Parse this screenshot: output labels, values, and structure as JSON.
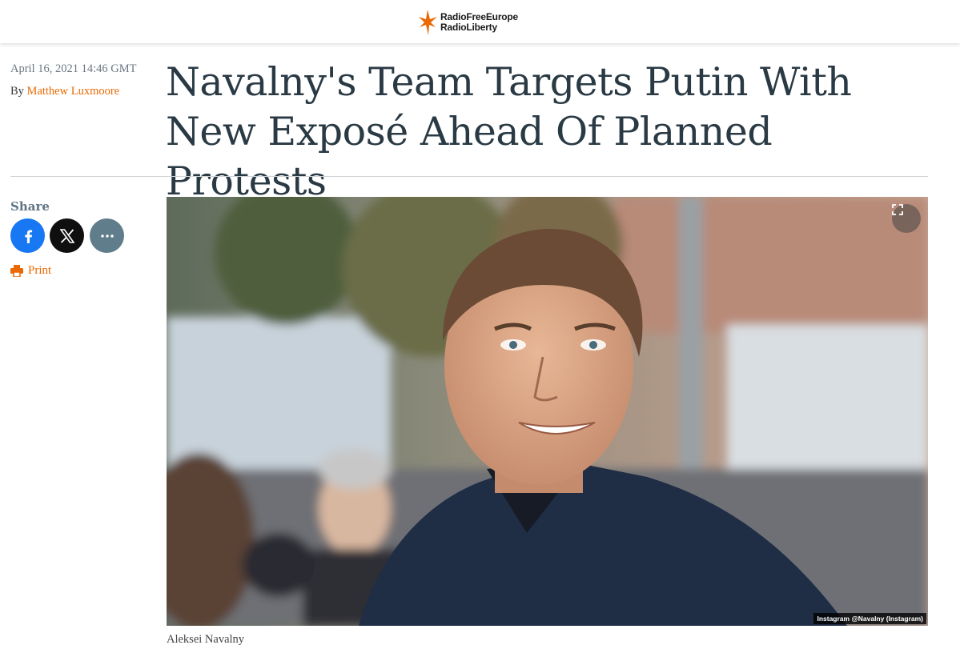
{
  "header": {
    "logo_line1": "RadioFreeEurope",
    "logo_line2": "RadioLiberty",
    "brand_color": "#ea6903"
  },
  "article": {
    "date": "April 16, 2021 14:46 GMT",
    "by_prefix": "By",
    "author": "Matthew Luxmoore",
    "title": "Navalny's Team Targets Putin With New Exposé Ahead Of Planned Protests"
  },
  "share": {
    "label": "Share",
    "facebook_icon": "facebook-icon",
    "x_icon": "x-icon",
    "more_icon": "more-icon",
    "facebook_color": "#1877f2",
    "x_color": "#0f0f0f",
    "more_color": "#607d8b"
  },
  "print": {
    "label": "Print",
    "icon": "printer-icon"
  },
  "media": {
    "credit": "Instagram @Navalny (Instagram)",
    "caption": "Aleksei Navalny",
    "expand_icon": "expand-icon"
  }
}
